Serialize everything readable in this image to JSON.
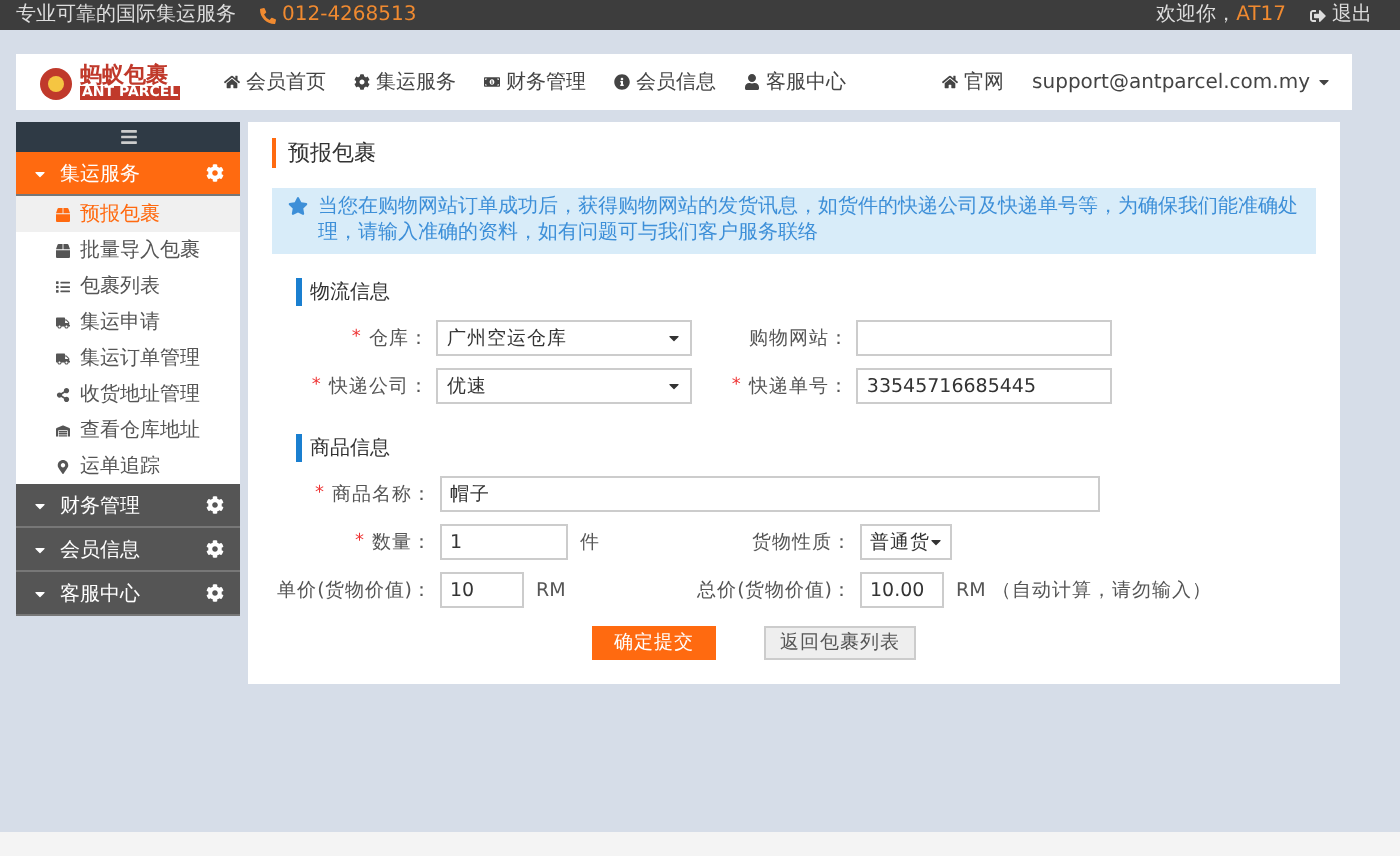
{
  "topbar": {
    "slogan": "专业可靠的国际集运服务",
    "phone": "012-4268513",
    "welcome": "欢迎你，",
    "username": "AT17",
    "logout": "退出"
  },
  "logo": {
    "chinese": "蚂蚁包裹",
    "english": "ANT PARCEL"
  },
  "nav": [
    {
      "label": "会员首页"
    },
    {
      "label": "集运服务"
    },
    {
      "label": "财务管理"
    },
    {
      "label": "会员信息"
    },
    {
      "label": "客服中心"
    }
  ],
  "nav_right": {
    "site": "官网",
    "account": "support@antparcel.com.my"
  },
  "sidebar": [
    {
      "label": "集运服务",
      "expanded": true,
      "children": [
        {
          "label": "预报包裹",
          "selected": true
        },
        {
          "label": "批量导入包裹",
          "selected": false
        },
        {
          "label": "包裹列表",
          "selected": false
        },
        {
          "label": "集运申请",
          "selected": false
        },
        {
          "label": "集运订单管理",
          "selected": false
        },
        {
          "label": "收货地址管理",
          "selected": false
        },
        {
          "label": "查看仓库地址",
          "selected": false
        },
        {
          "label": "运单追踪",
          "selected": false
        }
      ]
    },
    {
      "label": "财务管理",
      "expanded": false
    },
    {
      "label": "会员信息",
      "expanded": false
    },
    {
      "label": "客服中心",
      "expanded": false
    }
  ],
  "page_title": "预报包裹",
  "notice": "当您在购物网站订单成功后，获得购物网站的发货讯息，如货件的快递公司及快递单号等，为确保我们能准确处理，请输入准确的资料，如有问题可与我们客户服务联络",
  "sections": [
    {
      "title": "物流信息",
      "rows": [
        [
          {
            "required_mark": "*",
            "label": "仓库：",
            "kind": "select",
            "value": "广州空运仓库"
          },
          {
            "label": "购物网站：",
            "kind": "input"
          }
        ],
        [
          {
            "required_mark": "*",
            "label": "快递公司：",
            "kind": "select",
            "value": "优速"
          },
          {
            "required_mark": "*",
            "label": "快递单号：",
            "kind": "input",
            "value": "33545716685445"
          }
        ]
      ]
    },
    {
      "title": "商品信息",
      "rows": [
        [
          {
            "required_mark": "*",
            "label": "商品名称：",
            "kind": "input",
            "value": "帽子"
          }
        ],
        [
          {
            "required_mark": "*",
            "label": "数量：",
            "kind": "input",
            "value": "1",
            "unit": "件"
          },
          {
            "label": "货物性质：",
            "kind": "select",
            "value": "普通货"
          }
        ],
        [
          {
            "label": "单价(货物价值)：",
            "kind": "input",
            "value": "10",
            "unit": "RM"
          },
          {
            "label": "总价(货物价值)：",
            "kind": "input",
            "value": "10.00",
            "unit": "RM （自动计算，请勿输入）"
          }
        ]
      ]
    }
  ],
  "buttons": [
    {
      "label": "确定提交",
      "kind": "primary"
    },
    {
      "label": "返回包裹列表",
      "kind": "secondary"
    }
  ]
}
